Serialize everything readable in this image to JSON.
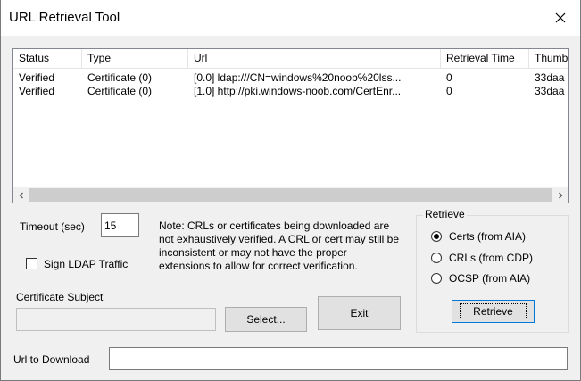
{
  "window": {
    "title": "URL Retrieval Tool"
  },
  "list": {
    "columns": [
      "Status",
      "Type",
      "Url",
      "Retrieval Time",
      "Thumb"
    ],
    "rows": [
      {
        "status": "Verified",
        "type": "Certificate (0)",
        "url": "[0.0] ldap:///CN=windows%20noob%20lss...",
        "time": "0",
        "thumb": "33daa"
      },
      {
        "status": "Verified",
        "type": "Certificate (0)",
        "url": "[1.0] http://pki.windows-noob.com/CertEnr...",
        "time": "0",
        "thumb": "33daa"
      }
    ]
  },
  "timeout": {
    "label": "Timeout (sec)",
    "value": "15"
  },
  "sign_ldap": {
    "label": "Sign LDAP Traffic"
  },
  "note": {
    "text": "Note: CRLs or certificates being downloaded are not exhaustively verified.  A CRL or cert may still be inconsistent or may not have the proper extensions to allow for correct verification."
  },
  "cert_subject": {
    "label": "Certificate Subject",
    "value": ""
  },
  "buttons": {
    "select": "Select...",
    "exit": "Exit",
    "retrieve": "Retrieve"
  },
  "retrieve_group": {
    "title": "Retrieve",
    "options": [
      "Certs (from AIA)",
      "CRLs (from CDP)",
      "OCSP (from AIA)"
    ],
    "selected": "Certs (from AIA)"
  },
  "url_download": {
    "label": "Url to Download",
    "value": ""
  }
}
